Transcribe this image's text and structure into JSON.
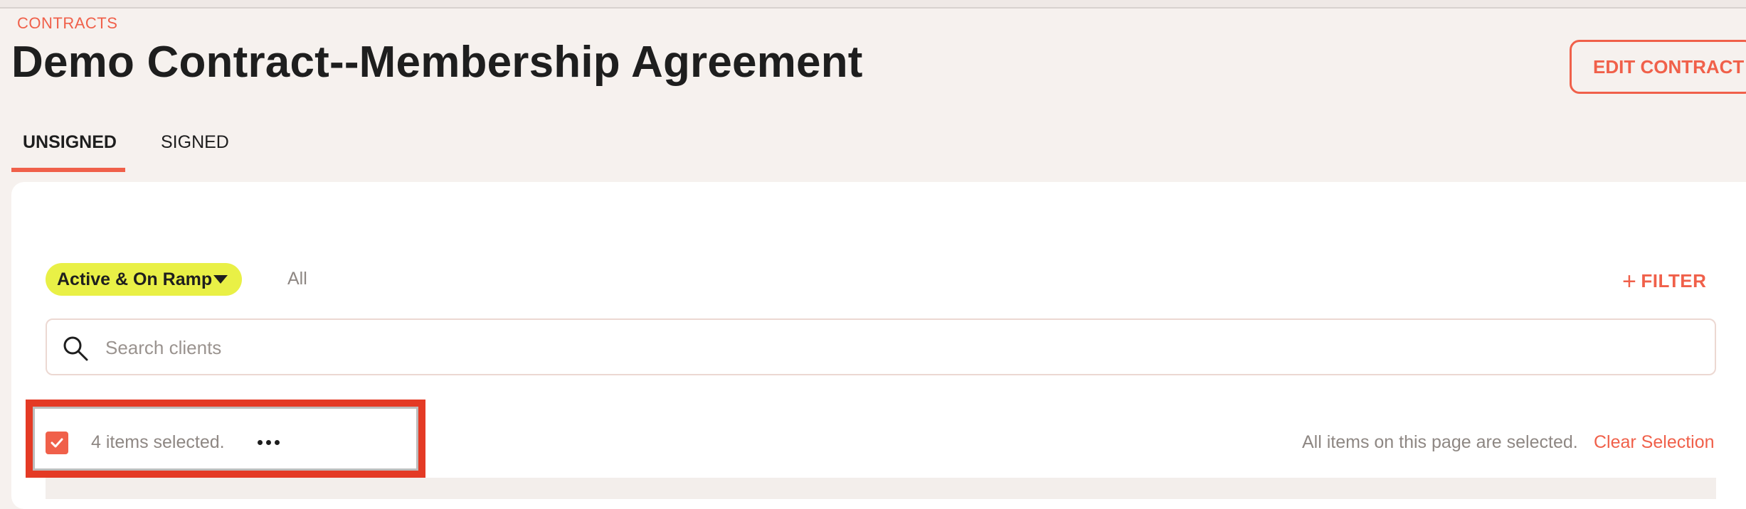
{
  "breadcrumb": "CONTRACTS",
  "page_title": "Demo Contract--Membership Agreement",
  "header": {
    "edit_label": "EDIT CONTRACT"
  },
  "tabs": [
    {
      "label": "UNSIGNED",
      "active": true
    },
    {
      "label": "SIGNED",
      "active": false
    }
  ],
  "filters": {
    "status_chip": "Active & On Ramp",
    "all_label": "All",
    "add_filter_label": "FILTER",
    "chip_color": "#e9f046"
  },
  "search": {
    "placeholder": "Search clients",
    "value": ""
  },
  "selection": {
    "count_text": "4 items selected.",
    "page_note": "All items on this page are selected.",
    "clear_label": "Clear Selection",
    "checked": true
  },
  "colors": {
    "accent": "#f0604a",
    "highlight_box": "#e43a25",
    "background": "#f6f1ee"
  },
  "icons": {
    "search": "search-icon",
    "checkbox": "check-icon",
    "more": "more-horizontal-icon",
    "plus": "plus-icon",
    "caret": "caret-down-icon"
  }
}
